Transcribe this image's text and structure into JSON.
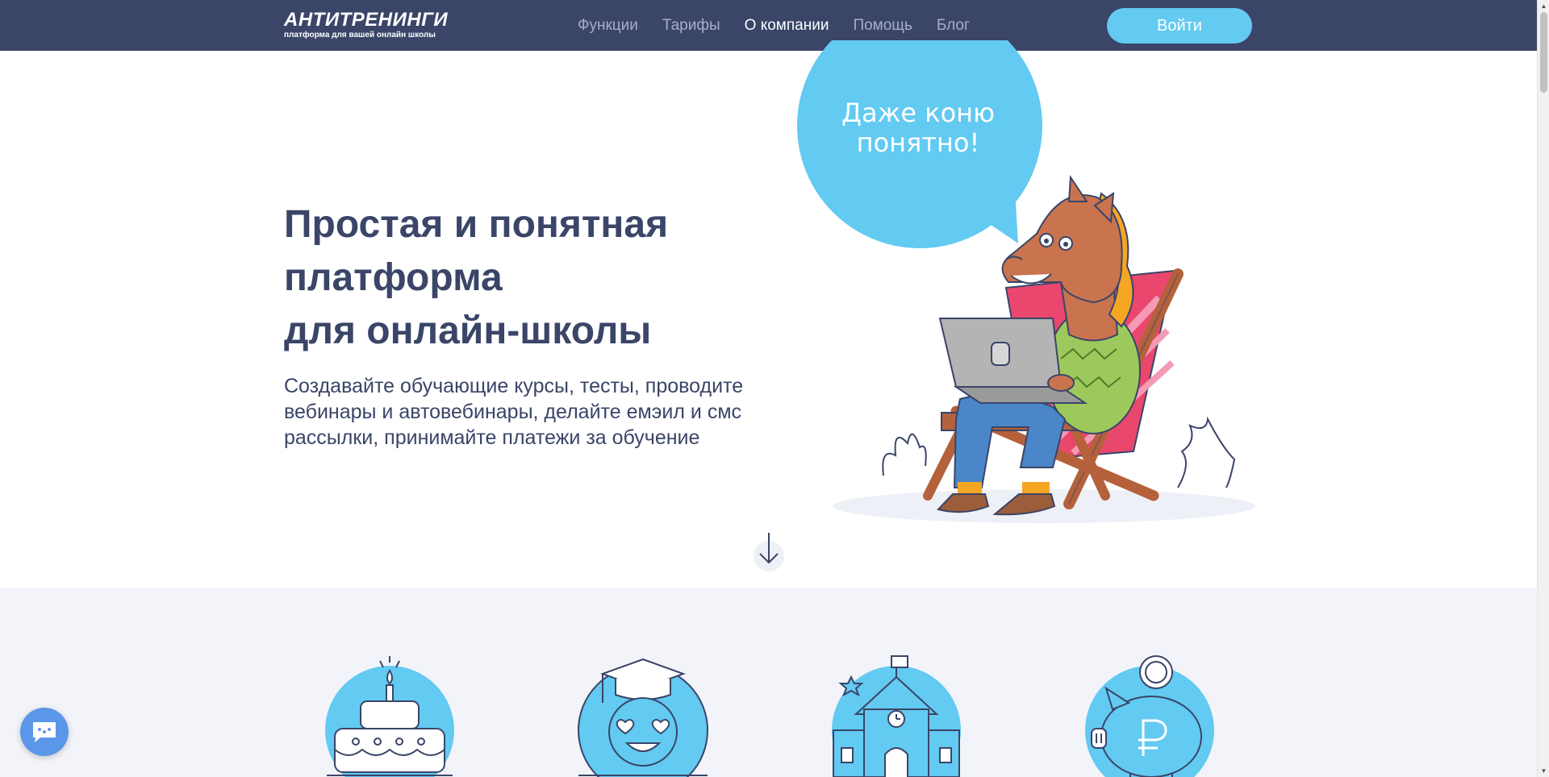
{
  "header": {
    "logo_title": "АНТИТРЕНИНГИ",
    "logo_subtitle": "платформа для вашей онлайн школы",
    "nav": [
      {
        "label": "Функции"
      },
      {
        "label": "Тарифы"
      },
      {
        "label": "О компании"
      },
      {
        "label": "Помощь"
      },
      {
        "label": "Блог"
      }
    ],
    "active_nav": "О компании",
    "login_label": "Войти"
  },
  "hero": {
    "title_lines": [
      "Простая и понятная",
      "платформа",
      "для онлайн-школы"
    ],
    "description": "Создавайте обучающие курсы, тесты, проводите вебинары и автовебинары, делайте емэил и смс рассылки, принимайте платежи за обучение",
    "bubble_text_lines": [
      "Даже коню",
      "понятно!"
    ]
  },
  "icons": {
    "scroll": "arrow-down-icon",
    "features": [
      "cake-icon",
      "graduate-smiley-icon",
      "school-building-icon",
      "piggy-bank-ruble-icon"
    ],
    "chat": "chat-bubble-icon"
  },
  "colors": {
    "header_bg": "#3a4568",
    "accent": "#63caf2",
    "text_dark": "#3a4568",
    "nav_inactive": "#a6aec6",
    "features_bg": "#f3f4f9"
  }
}
